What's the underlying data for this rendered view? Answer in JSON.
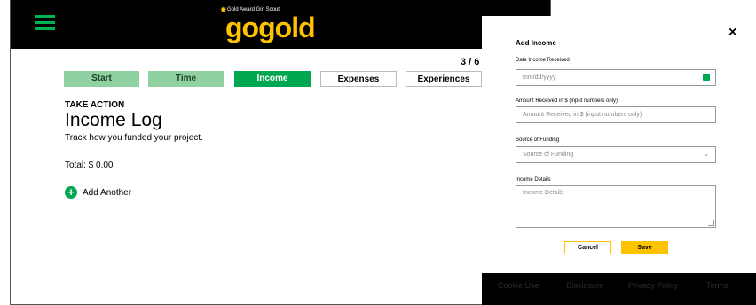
{
  "header": {
    "logo_tagline": "Gold Award Girl Scout",
    "logo_word": "gogold"
  },
  "progress": {
    "counter": "3 / 6",
    "steps": [
      {
        "label": "Start",
        "state": "done"
      },
      {
        "label": "Time",
        "state": "done"
      },
      {
        "label": "Income",
        "state": "active"
      },
      {
        "label": "Expenses",
        "state": "todo"
      },
      {
        "label": "Experiences",
        "state": "todo"
      }
    ]
  },
  "main": {
    "eyebrow": "TAKE ACTION",
    "title": "Income Log",
    "subtitle": "Track how you funded your project.",
    "total": "Total: $ 0.00",
    "add_another": "Add Another"
  },
  "footer_links": [
    "Cookie Use",
    "Disclosure",
    "Privacy Policy",
    "Terms"
  ],
  "modal": {
    "title": "Add Income",
    "close": "×",
    "date_label": "Date Income Received",
    "date_placeholder": "mm/dd/yyyy",
    "amount_label": "Amount Received in $ (input numbers only)",
    "amount_placeholder": "Amount Received in $ (input numbers only)",
    "source_label": "Source of Funding",
    "source_value": "Source of Funding",
    "details_label": "Income Details",
    "details_placeholder": "Income Details",
    "cancel": "Cancel",
    "save": "Save"
  },
  "colors": {
    "brand_green": "#00a650",
    "brand_gold": "#fdc300",
    "done_green": "#8fd1a0"
  }
}
